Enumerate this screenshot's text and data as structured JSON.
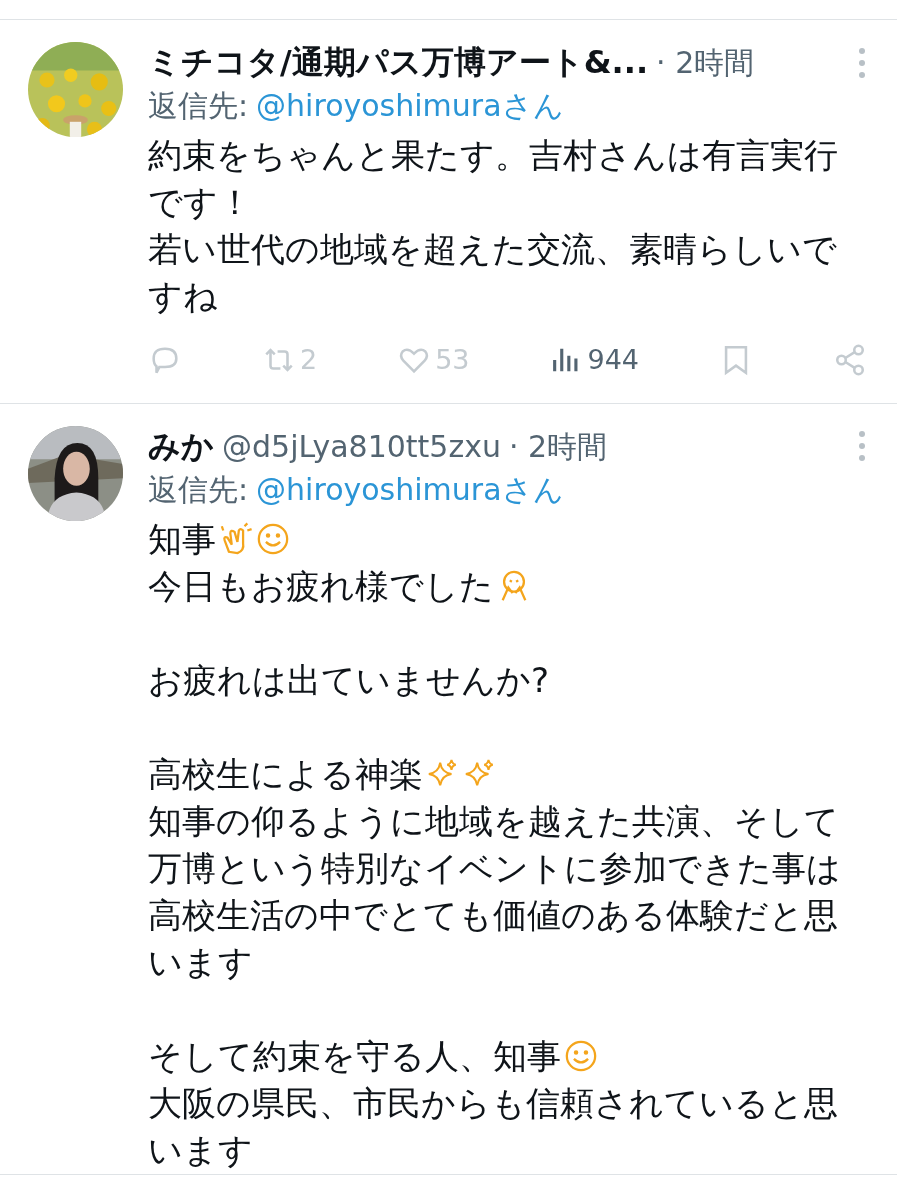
{
  "replies": [
    {
      "author": {
        "name": "ミチコタ/通期パス万博アート&...",
        "time": "· 2時間"
      },
      "reply_to": {
        "label": "返信先:",
        "handle": "@hiroyoshimuraさん"
      },
      "paragraphs": [
        [
          {
            "text": "約束をちゃんと果たす。吉村さんは有言実行"
          },
          {
            "text": "です！"
          },
          {
            "text": "若い世代の地域を超えた交流、素晴らしいで"
          },
          {
            "text": "すね"
          }
        ]
      ],
      "actions": [
        {
          "kind": "reply"
        },
        {
          "kind": "retweet",
          "count": "2"
        },
        {
          "kind": "like",
          "count": "53"
        },
        {
          "kind": "views",
          "count": "944"
        },
        {
          "kind": "bookmark"
        },
        {
          "kind": "share"
        }
      ]
    },
    {
      "author": {
        "name": "みか",
        "handle": "@d5jLya810tt5zxu",
        "time": "· 2時間"
      },
      "reply_to": {
        "label": "返信先:",
        "handle": "@hiroyoshimuraさん"
      },
      "paragraphs": [
        [
          {
            "text": "知事",
            "emoji": [
              {
                "kind": "clap"
              },
              {
                "kind": "smile"
              }
            ]
          },
          {
            "text": "今日もお疲れ様でした",
            "emoji": [
              {
                "kind": "facepalm"
              }
            ]
          }
        ],
        [
          {
            "text": "お疲れは出ていませんか?"
          }
        ],
        [
          {
            "text": "高校生による神楽",
            "emoji": [
              {
                "kind": "sparkles"
              },
              {
                "kind": "sparkles"
              }
            ]
          },
          {
            "text": "知事の仰るように地域を越えた共演、そして"
          },
          {
            "text": "万博という特別なイベントに参加できた事は"
          },
          {
            "text": "高校生活の中でとても価値のある体験だと思"
          },
          {
            "text": "います"
          }
        ],
        [
          {
            "text": "そして約束を守る人、知事",
            "emoji": [
              {
                "kind": "smile"
              }
            ]
          },
          {
            "text": "大阪の県民、市民からも信頼されていると思"
          },
          {
            "text": "います"
          }
        ]
      ]
    }
  ]
}
